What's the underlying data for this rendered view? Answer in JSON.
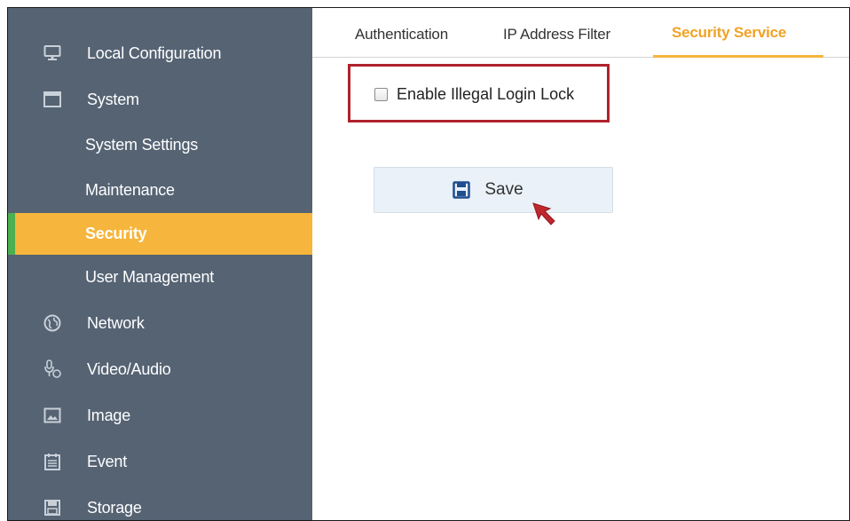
{
  "sidebar": {
    "items": [
      {
        "label": "Local Configuration",
        "icon": "monitor-icon"
      },
      {
        "label": "System",
        "icon": "window-icon"
      },
      {
        "label": "System Settings"
      },
      {
        "label": "Maintenance"
      },
      {
        "label": "Security",
        "active": true
      },
      {
        "label": "User Management"
      },
      {
        "label": "Network",
        "icon": "globe-icon"
      },
      {
        "label": "Video/Audio",
        "icon": "microphone-icon"
      },
      {
        "label": "Image",
        "icon": "image-icon"
      },
      {
        "label": "Event",
        "icon": "calendar-icon"
      },
      {
        "label": "Storage",
        "icon": "floppy-disk-icon"
      }
    ]
  },
  "tabs": [
    {
      "label": "Authentication"
    },
    {
      "label": "IP Address Filter"
    },
    {
      "label": "Security Service",
      "active": true
    }
  ],
  "form": {
    "illegal_login_lock_label": "Enable Illegal Login Lock",
    "illegal_login_lock_checked": false,
    "save_label": "Save"
  },
  "colors": {
    "sidebar_bg": "#556373",
    "active_item_bg": "#f6b53c",
    "active_tab_text": "#f0a326",
    "highlight_border": "#b0222b",
    "save_icon": "#1f4f8f",
    "cursor": "#c0282e"
  }
}
